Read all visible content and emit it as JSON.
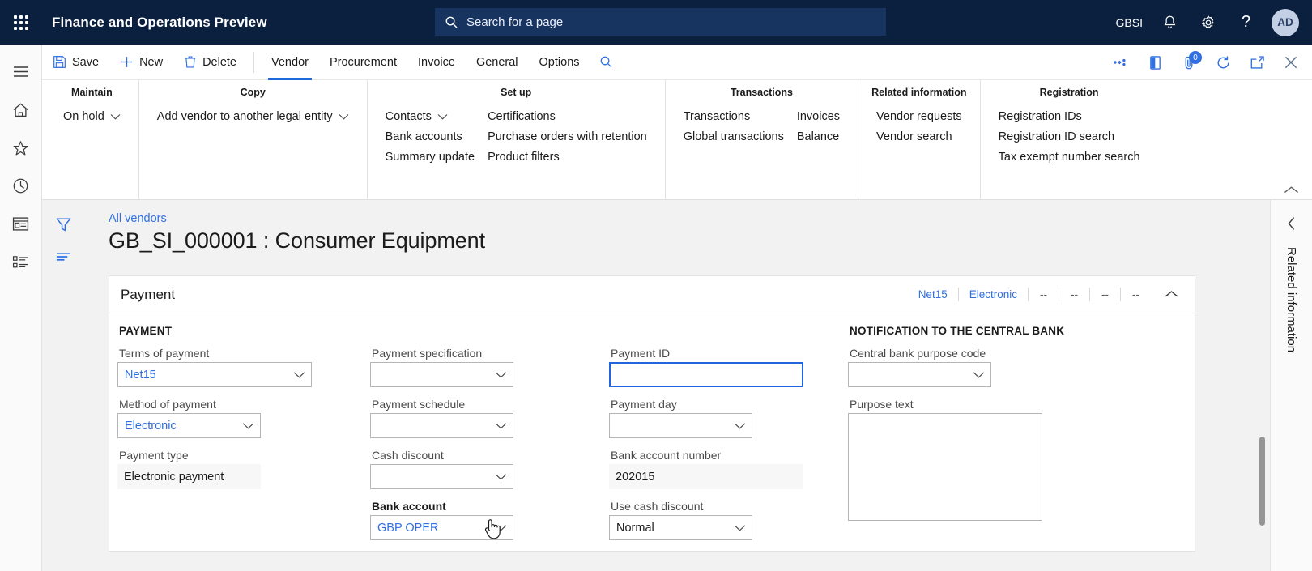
{
  "topbar": {
    "waffle_name": "app-launcher",
    "app_title": "Finance and Operations Preview",
    "search_placeholder": "Search for a page",
    "company": "GBSI",
    "avatar_initials": "AD",
    "help_glyph": "?"
  },
  "command_bar": {
    "save_label": "Save",
    "new_label": "New",
    "delete_label": "Delete",
    "tabs": [
      {
        "label": "Vendor",
        "active": true
      },
      {
        "label": "Procurement",
        "active": false
      },
      {
        "label": "Invoice",
        "active": false
      },
      {
        "label": "General",
        "active": false
      },
      {
        "label": "Options",
        "active": false
      }
    ],
    "attachment_badge": "0"
  },
  "ribbon": {
    "groups": [
      {
        "title": "Maintain",
        "columns": [
          {
            "items": [
              {
                "label": "On hold",
                "caret": true
              }
            ]
          }
        ]
      },
      {
        "title": "Copy",
        "columns": [
          {
            "items": [
              {
                "label": "Add vendor to another legal entity",
                "caret": true
              }
            ]
          }
        ]
      },
      {
        "title": "Set up",
        "columns": [
          {
            "items": [
              {
                "label": "Contacts",
                "caret": true
              },
              {
                "label": "Bank accounts",
                "caret": false
              },
              {
                "label": "Summary update",
                "caret": false
              }
            ]
          },
          {
            "items": [
              {
                "label": "Certifications",
                "caret": false
              },
              {
                "label": "Purchase orders with retention",
                "caret": false
              },
              {
                "label": "Product filters",
                "caret": false
              }
            ]
          }
        ]
      },
      {
        "title": "Transactions",
        "columns": [
          {
            "items": [
              {
                "label": "Transactions",
                "caret": false
              },
              {
                "label": "Global transactions",
                "caret": false
              }
            ]
          },
          {
            "items": [
              {
                "label": "Invoices",
                "caret": false
              },
              {
                "label": "Balance",
                "caret": false
              }
            ]
          }
        ]
      },
      {
        "title": "Related information",
        "columns": [
          {
            "items": [
              {
                "label": "Vendor requests",
                "caret": false
              },
              {
                "label": "Vendor search",
                "caret": false
              }
            ]
          }
        ]
      },
      {
        "title": "Registration",
        "columns": [
          {
            "items": [
              {
                "label": "Registration IDs",
                "caret": false
              },
              {
                "label": "Registration ID search",
                "caret": false
              },
              {
                "label": "Tax exempt number search",
                "caret": false
              }
            ]
          }
        ]
      }
    ]
  },
  "page": {
    "breadcrumb": "All vendors",
    "title": "GB_SI_000001 : Consumer Equipment"
  },
  "fasttab": {
    "title": "Payment",
    "summary": [
      {
        "text": "Net15",
        "dim": false
      },
      {
        "text": "Electronic",
        "dim": false
      },
      {
        "text": "--",
        "dim": true
      },
      {
        "text": "--",
        "dim": true
      },
      {
        "text": "--",
        "dim": true
      },
      {
        "text": "--",
        "dim": true
      }
    ]
  },
  "form": {
    "section_payment": "PAYMENT",
    "section_central_bank": "NOTIFICATION TO THE CENTRAL BANK",
    "col1": [
      {
        "label": "Terms of payment",
        "value": "Net15",
        "type": "combo",
        "link": true,
        "width": "w-240"
      },
      {
        "label": "Method of payment",
        "value": "Electronic",
        "type": "combo",
        "link": true,
        "width": "w-177"
      },
      {
        "label": "Payment type",
        "value": "Electronic payment",
        "type": "readonly",
        "width": "w-177"
      }
    ],
    "col2": [
      {
        "label": "Payment specification",
        "value": "",
        "type": "combo",
        "link": false,
        "width": "w-177"
      },
      {
        "label": "Payment schedule",
        "value": "",
        "type": "combo",
        "link": false,
        "width": "w-177"
      },
      {
        "label": "Cash discount",
        "value": "",
        "type": "combo",
        "link": false,
        "width": "w-177"
      },
      {
        "label": "Bank account",
        "value": "GBP OPER",
        "type": "combo",
        "link": true,
        "width": "w-177",
        "label_hover": true
      }
    ],
    "col3": [
      {
        "label": "Payment ID",
        "value": "",
        "type": "text",
        "focused": true,
        "width": "w-240"
      },
      {
        "label": "Payment day",
        "value": "",
        "type": "combo",
        "link": false,
        "width": "w-177"
      },
      {
        "label": "Bank account number",
        "value": "202015",
        "type": "readonly",
        "width": "w-240"
      },
      {
        "label": "Use cash discount",
        "value": "Normal",
        "type": "combo",
        "link": false,
        "width": "w-177"
      }
    ],
    "col4": [
      {
        "label": "Central bank purpose code",
        "value": "",
        "type": "combo",
        "link": false,
        "width": "w-177"
      },
      {
        "label": "Purpose text",
        "value": "",
        "type": "textarea",
        "width": "w-240"
      }
    ]
  },
  "right_dock": {
    "label": "Related information"
  },
  "colors": {
    "nav_background": "#0b1f3f",
    "accent_blue": "#2f6fe0",
    "tab_underline": "#2266dd",
    "content_background": "#f2f2f2"
  }
}
